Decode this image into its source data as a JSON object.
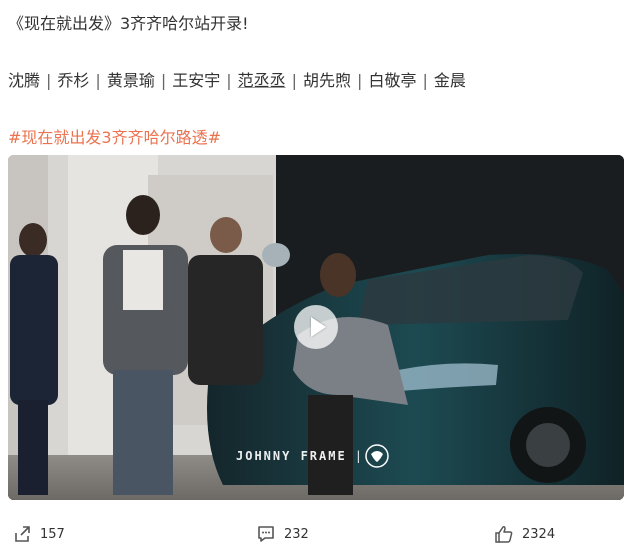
{
  "post": {
    "title": "《现在就出发》3齐齐哈尔站开录!",
    "cast": [
      "沈腾",
      "乔杉",
      "黄景瑜",
      "王安宇",
      "范丞丞",
      "胡先煦",
      "白敬亭",
      "金晨"
    ],
    "cast_separator": "|",
    "hashtag": "#现在就出发3齐齐哈尔路透#"
  },
  "video": {
    "watermark_text": "JOHNNY FRAME",
    "watermark_separator": "|",
    "play_icon": "play-icon"
  },
  "actions": {
    "share_icon": "share-icon",
    "share_count": "157",
    "comment_icon": "comment-icon",
    "comment_count": "232",
    "like_icon": "thumbs-up-icon",
    "like_count": "2324"
  },
  "colors": {
    "hashtag": "#eb7350",
    "text": "#333333",
    "car_body": "#1d3c42"
  }
}
